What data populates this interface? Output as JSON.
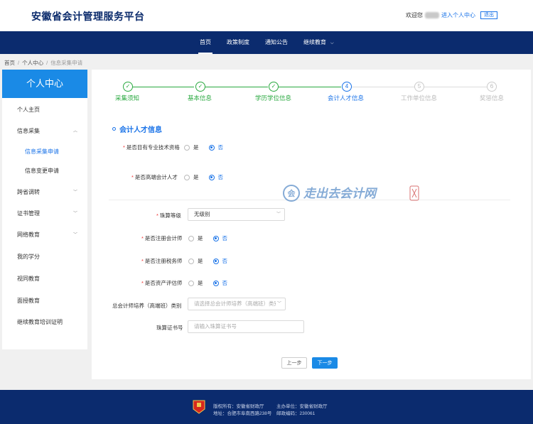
{
  "header": {
    "site_title": "安徽省会计管理服务平台",
    "welcome": "欢迎您",
    "enter_center": "进入个人中心",
    "logout": "退出"
  },
  "nav": {
    "items": [
      {
        "label": "首页",
        "active": true
      },
      {
        "label": "政策制度"
      },
      {
        "label": "通知公告"
      },
      {
        "label": "继续教育",
        "has_dropdown": true
      }
    ]
  },
  "breadcrumb": [
    "首页",
    "个人中心",
    "信息采集申请"
  ],
  "sidebar": {
    "title": "个人中心",
    "items": [
      {
        "label": "个人主页"
      },
      {
        "label": "信息采集",
        "expanded": true
      },
      {
        "label": "信息采集申请",
        "sub": true,
        "active": true
      },
      {
        "label": "信息变更申请",
        "sub": true
      },
      {
        "label": "跨省调转",
        "collapsible": true
      },
      {
        "label": "证书管理",
        "collapsible": true
      },
      {
        "label": "网络教育",
        "collapsible": true
      },
      {
        "label": "我的学分"
      },
      {
        "label": "视同教育"
      },
      {
        "label": "面授教育"
      },
      {
        "label": "继续教育培训证明"
      }
    ]
  },
  "steps": [
    {
      "label": "采集须知",
      "status": "done"
    },
    {
      "label": "基本信息",
      "status": "done"
    },
    {
      "label": "学历学位信息",
      "status": "done"
    },
    {
      "label": "会计人才信息",
      "number": "4",
      "status": "current"
    },
    {
      "label": "工作单位信息",
      "number": "5",
      "status": "pending"
    },
    {
      "label": "奖惩信息",
      "number": "6",
      "status": "pending"
    }
  ],
  "section_title": "会计人才信息",
  "form": {
    "tech_qualification": {
      "label": "是否目有专业技术资格",
      "yes": "是",
      "no": "否",
      "value": "否"
    },
    "senior_talent": {
      "label": "是否高端会计人才",
      "yes": "是",
      "no": "否",
      "value": "否"
    },
    "abacus_level": {
      "label": "珠算等级",
      "value": "无级别"
    },
    "cpa": {
      "label": "是否注册会计师",
      "yes": "是",
      "no": "否",
      "value": "否"
    },
    "tax_agent": {
      "label": "是否注册税务师",
      "yes": "是",
      "no": "否",
      "value": "否"
    },
    "asset_appraiser": {
      "label": "是否资产评估师",
      "yes": "是",
      "no": "否",
      "value": "否"
    },
    "cfo_training": {
      "label": "总会计师培养（高端班）类别",
      "placeholder": "请选择总会计师培养（高端班）类别"
    },
    "abacus_cert": {
      "label": "珠算证书号",
      "placeholder": "请输入珠算证书号"
    }
  },
  "buttons": {
    "prev": "上一步",
    "next": "下一步"
  },
  "watermark": {
    "text": "走出去会计网"
  },
  "footer": {
    "copyright": "版权所有：安徽省财政厅",
    "sponsor": "主办单位：安徽省财政厅",
    "address": "地址：合肥市阜南西路238号",
    "postcode": "邮政编码：230061"
  },
  "colors": {
    "primary": "#1a73e8",
    "nav_bg": "#0b2b6e",
    "sidebar_head": "#1a8ae6",
    "step_done": "#2aa940"
  }
}
